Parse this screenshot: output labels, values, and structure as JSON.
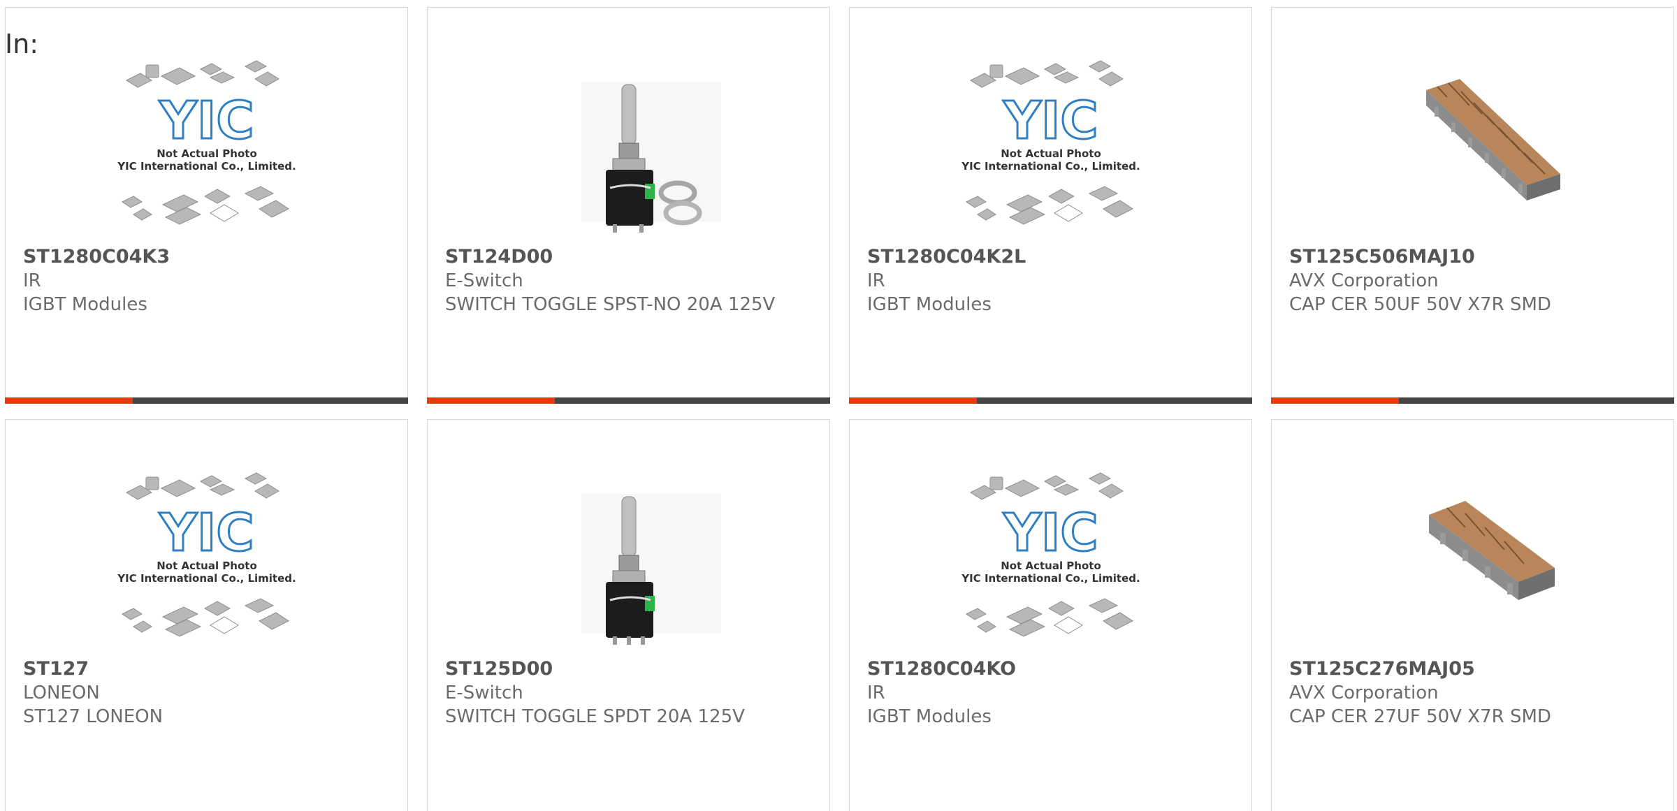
{
  "header": {
    "in_label": "In:"
  },
  "placeholder": {
    "line1": "Not Actual Photo",
    "line2": "YIC International Co., Limited.",
    "logo": "YIC"
  },
  "colors": {
    "accent": "#e8380d",
    "bar": "#454545",
    "text": "#6b6b6b"
  },
  "products": [
    {
      "part": "ST1280C04K3",
      "manufacturer": "IR",
      "description": "IGBT Modules",
      "image": "placeholder-image"
    },
    {
      "part": "ST124D00",
      "manufacturer": "E-Switch",
      "description": "SWITCH TOGGLE SPST-NO 20A 125V",
      "image": "toggle-switch-with-nuts"
    },
    {
      "part": "ST1280C04K2L",
      "manufacturer": "IR",
      "description": "IGBT Modules",
      "image": "placeholder-image"
    },
    {
      "part": "ST125C506MAJ10",
      "manufacturer": "AVX Corporation",
      "description": "CAP CER 50UF 50V X7R SMD",
      "image": "capacitor-stack-long"
    },
    {
      "part": "ST127",
      "manufacturer": "LONEON",
      "description": "ST127 LONEON",
      "image": "placeholder-image"
    },
    {
      "part": "ST125D00",
      "manufacturer": "E-Switch",
      "description": "SWITCH TOGGLE SPDT 20A 125V",
      "image": "toggle-switch"
    },
    {
      "part": "ST1280C04KO",
      "manufacturer": "IR",
      "description": "IGBT Modules",
      "image": "placeholder-image"
    },
    {
      "part": "ST125C276MAJ05",
      "manufacturer": "AVX Corporation",
      "description": "CAP CER 27UF 50V X7R SMD",
      "image": "capacitor-stack-short"
    }
  ]
}
